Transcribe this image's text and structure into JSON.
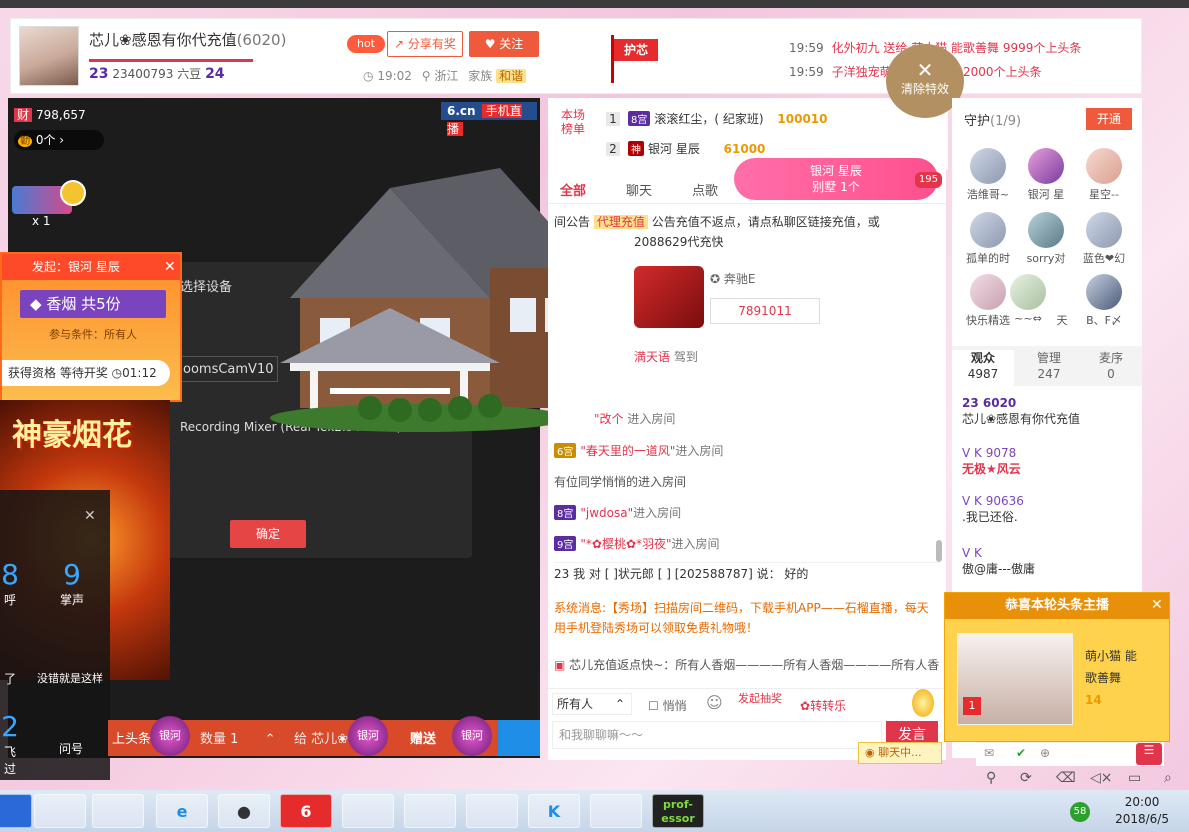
{
  "header": {
    "anchor_name": "芯儿❀感恩有你代充值",
    "anchor_count": "(6020)",
    "level_left": "23",
    "room_id": "23400793",
    "beans": "六豆",
    "level_right": "24",
    "hot_label": "hot",
    "share_label": "分享有奖",
    "follow_label": "关注",
    "time": "19:02",
    "location": "浙江",
    "family": "家族",
    "family_tag": "和谐",
    "guard_flag": "护芯"
  },
  "feed": [
    {
      "time": "19:59",
      "text": "化外初九 送给 萌小猫  能歌善舞 9999个上头条"
    },
    {
      "time": "19:59",
      "text": "子洋独宠萌…  ✿蓉儿✿ 12000个上头条"
    }
  ],
  "clear_effects": "清除特效",
  "video": {
    "logo": "6.cn",
    "logo_sub": "手机直播",
    "wealth": "798,657",
    "items": "0个",
    "select_device": "选择设备",
    "cam": "oomsCamV10",
    "recording": "Recording Mixer (Real Tek2.5 Audio (3",
    "confirm": "确定"
  },
  "left_panel": {
    "initiator": "发起：银河   星辰",
    "prize": "香烟 共5份",
    "condition": "参与条件：所有人",
    "wait": "获得资格 等待开奖",
    "countdown": "01:12",
    "shenhao": "神豪烟花",
    "x1": "x 1"
  },
  "left_icons": [
    {
      "num": "8",
      "label": "呼"
    },
    {
      "num": "9",
      "label": "掌声"
    },
    {
      "num": "",
      "label": "了"
    },
    {
      "num": "",
      "label": "没错就是这样"
    },
    {
      "num": "2",
      "label": "飞过"
    },
    {
      "num": "",
      "label": "问号"
    }
  ],
  "bottom_bar": {
    "headline": "上头条",
    "qty_label": "数量",
    "qty": "1",
    "give_to": "给  芯儿❀",
    "gift_btn": "赠送",
    "badge": "银河"
  },
  "rank": {
    "label": "本场榜单",
    "rows": [
      {
        "pos": "1",
        "medal": "8宫",
        "name": "滚滚红尘，( 纪家班)",
        "score": "100010"
      },
      {
        "pos": "2",
        "medal": "神",
        "name": "银河   星辰",
        "score": "61000"
      }
    ],
    "banner_name": "银河   星辰",
    "banner_sub": "别墅 1个",
    "banner_count": "195"
  },
  "chat": {
    "tabs": [
      "全部",
      "聊天",
      "点歌"
    ],
    "notice_prefix": "间公告",
    "notice_tag": "代理充值",
    "notice_text": "公告充值不返点，请点私聊区链接充值，或",
    "notice_text2": "2088629代充快",
    "car_name": "奔驰E",
    "car_value": "7891011",
    "messages": [
      {
        "medal": "",
        "user": "満天语",
        "text": " 驾到"
      },
      {
        "medal": "",
        "user": "\"改个",
        "text": " 进入房间"
      },
      {
        "medal": "6宫",
        "user": "\"春天里的一道风\"",
        "text": "进入房间"
      },
      {
        "medal": "",
        "user": "",
        "text": "有位同学悄悄的进入房间"
      },
      {
        "medal": "8宫",
        "user": "\"jwdosa\"",
        "text": "进入房间"
      },
      {
        "medal": "9宫",
        "user": "\"*✿樱桃✿*羽夜\"",
        "text": "进入房间"
      }
    ],
    "speech": "23  我 对 [ ]状元郎 [ ] [202588787] 说：   好的",
    "system": "系统消息:【秀场】扫描房间二维码，下载手机APP——石榴直播，每天用手机登陆秀场可以领取免费礼物哦！",
    "recharge": "芯儿充值返点快~：所有人香烟————所有人香烟————所有人香",
    "everyone": "所有人",
    "whisper": "悄悄",
    "lottery": "发起抽奖",
    "spin": "转转乐",
    "placeholder": "和我聊聊嘛～～",
    "send": "发言",
    "chatting": "聊天中..."
  },
  "right": {
    "guard_title": "守护",
    "guard_count": "(1/9)",
    "open": "开通",
    "guards": [
      "浩维哥~",
      "银河   星",
      "星空--",
      "孤单的时",
      "sorry对",
      "蓝色❤幻",
      "快乐精选",
      "~~⇔",
      "天",
      "B、F〆"
    ],
    "tabs": [
      {
        "label": "观众",
        "count": "4987"
      },
      {
        "label": "管理",
        "count": "247"
      },
      {
        "label": "麦序",
        "count": "0"
      }
    ],
    "users": [
      {
        "top": "23  6020",
        "bottom": "芯儿❀感恩有你代充值"
      },
      {
        "top": "V K  9078",
        "bottom": "无极★风云"
      },
      {
        "top": "V K  90636",
        "bottom": ".我已还俗."
      },
      {
        "top": "V K",
        "bottom": "傲@庸---傲庸"
      }
    ]
  },
  "congrats": {
    "title": "恭喜本轮头条主播",
    "name": "萌小猫   能",
    "name2": "歌善舞",
    "level": "14",
    "rank": "1"
  },
  "taskbar": {
    "time": "20:00",
    "date": "2018/6/5",
    "notify_count": "58",
    "apps": [
      "",
      "",
      "",
      "",
      "6",
      "",
      "",
      "",
      "",
      "K",
      "",
      "prof-\nessor"
    ]
  }
}
